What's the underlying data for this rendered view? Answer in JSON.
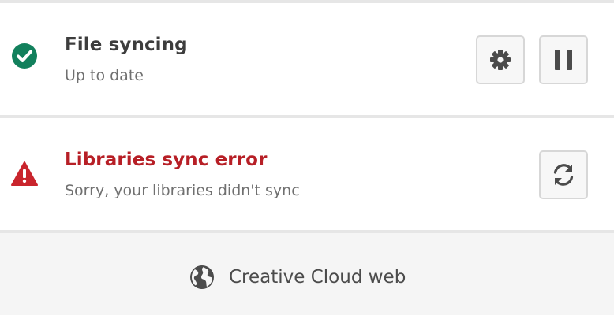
{
  "file_sync": {
    "title": "File syncing",
    "status": "Up to date",
    "status_icon": "check-circle-icon",
    "status_color": "#12805c",
    "actions": [
      {
        "name": "settings",
        "icon": "gear-icon"
      },
      {
        "name": "pause",
        "icon": "pause-icon"
      }
    ]
  },
  "libraries_sync": {
    "title": "Libraries sync error",
    "status": "Sorry, your libraries didn't sync",
    "status_icon": "alert-triangle-icon",
    "status_color": "#c9252d",
    "actions": [
      {
        "name": "retry",
        "icon": "refresh-icon"
      }
    ]
  },
  "footer": {
    "link_label": "Creative Cloud web",
    "link_icon": "globe-icon"
  },
  "colors": {
    "error_text": "#b71f26",
    "title_text": "#3d3d3d",
    "subtitle_text": "#707070",
    "icon_dark": "#4b4b4b"
  }
}
